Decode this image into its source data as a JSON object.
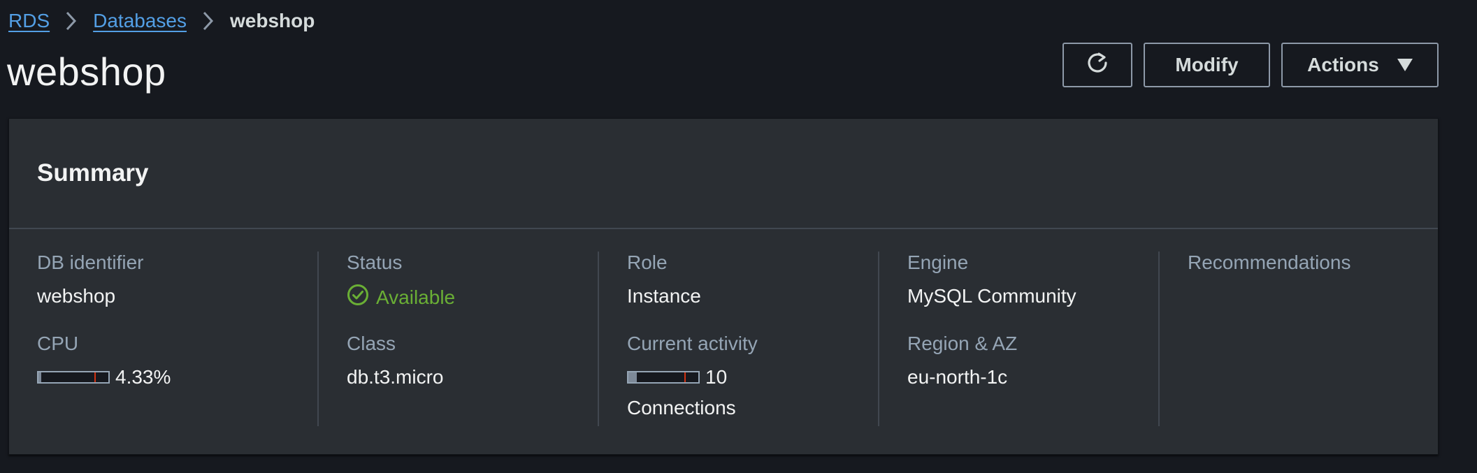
{
  "breadcrumb": {
    "items": [
      "RDS",
      "Databases"
    ],
    "current": "webshop"
  },
  "page": {
    "title": "webshop"
  },
  "header_buttons": {
    "refresh_icon": "refresh-icon",
    "modify_label": "Modify",
    "actions_label": "Actions",
    "actions_icon": "caret-down-icon"
  },
  "summary": {
    "title": "Summary",
    "columns": [
      {
        "label_1": "DB identifier",
        "value_1": "webshop",
        "label_2": "CPU",
        "cpu_percent_text": "4.33%",
        "cpu_percent": 4.33
      },
      {
        "label_1": "Status",
        "value_1": "Available",
        "status_icon": "check-circle-icon",
        "label_2": "Class",
        "value_2": "db.t3.micro"
      },
      {
        "label_1": "Role",
        "value_1": "Instance",
        "label_2": "Current activity",
        "connections_value": "10",
        "connections_label": "Connections"
      },
      {
        "label_1": "Engine",
        "value_1": "MySQL Community",
        "label_2": "Region & AZ",
        "value_2": "eu-north-1c"
      },
      {
        "label_1": "Recommendations"
      }
    ]
  },
  "colors": {
    "link": "#539fe5",
    "status_available": "#6aaf35",
    "background": "#16191f",
    "panel": "#2a2e33"
  }
}
